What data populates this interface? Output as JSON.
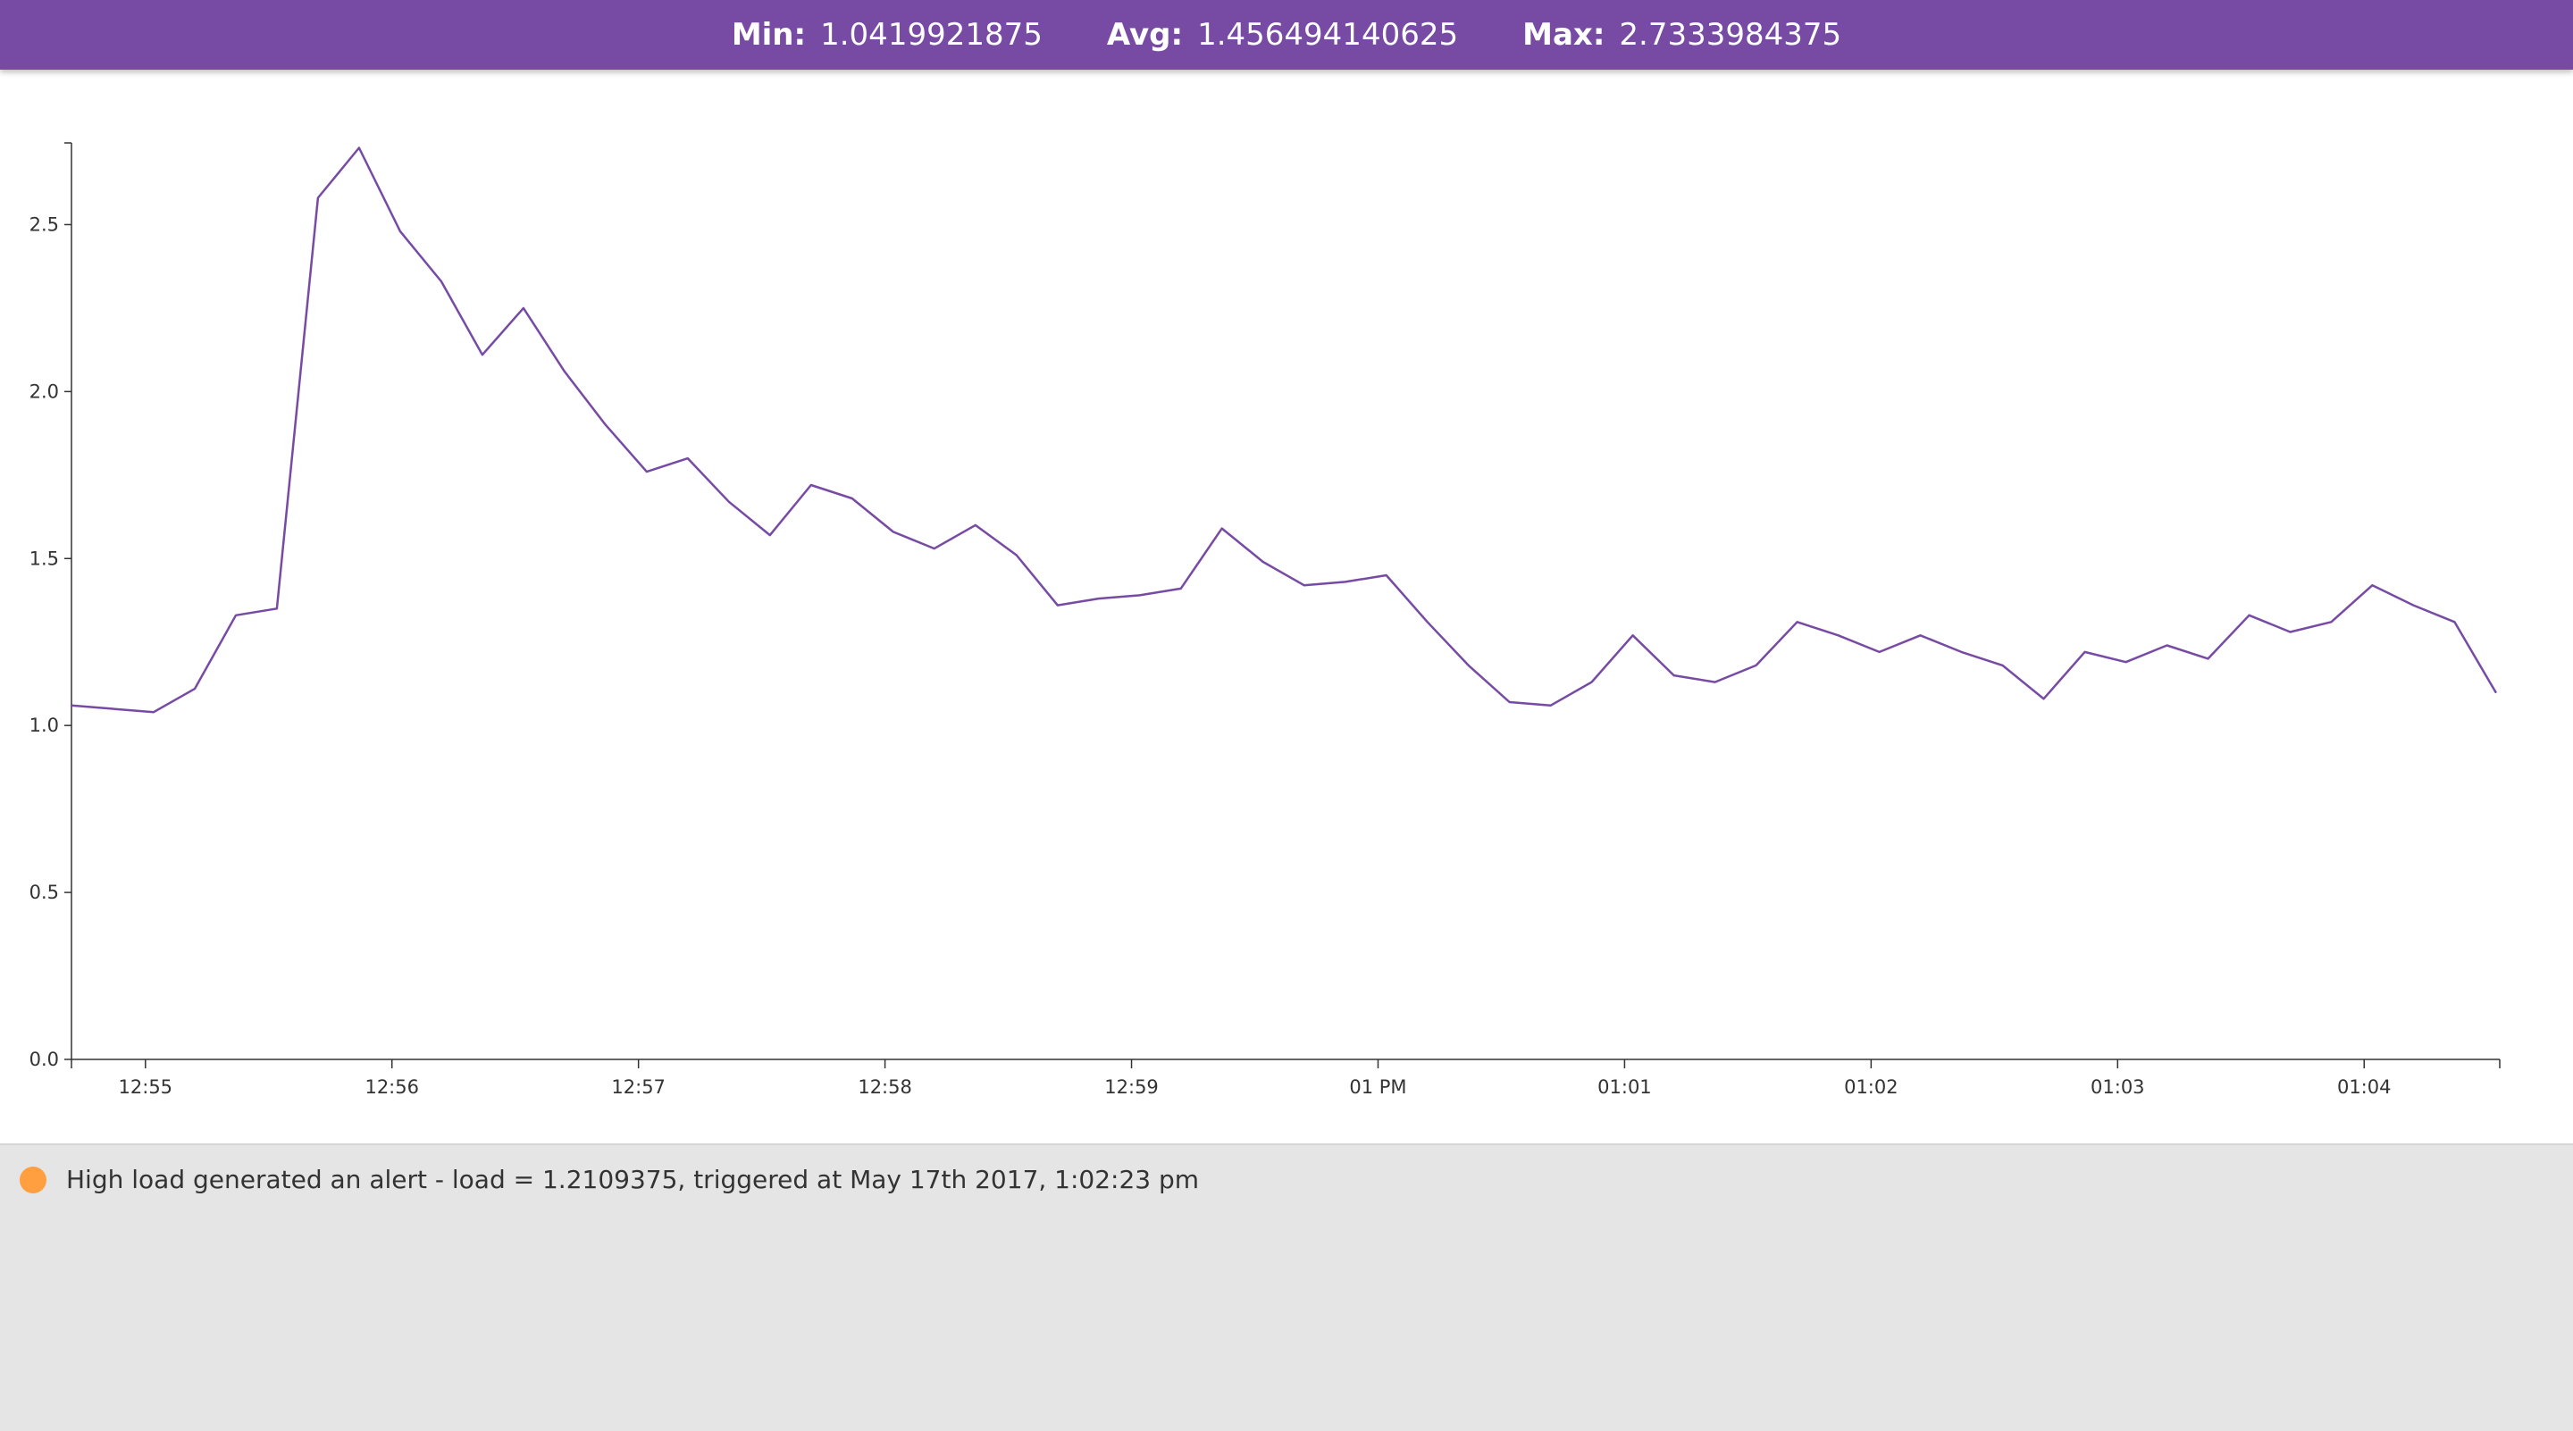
{
  "header": {
    "min_label": "Min:",
    "min_value": "1.0419921875",
    "avg_label": "Avg:",
    "avg_value": "1.456494140625",
    "max_label": "Max:",
    "max_value": "2.7333984375"
  },
  "chart_data": {
    "type": "line",
    "title": "",
    "xlabel": "",
    "ylabel": "",
    "grid": false,
    "ylim": [
      0,
      2.75
    ],
    "yticks": [
      "0.0",
      "0.5",
      "1.0",
      "1.5",
      "2.0",
      "2.5"
    ],
    "xticks": [
      "12:55",
      "12:56",
      "12:57",
      "12:58",
      "12:59",
      "01 PM",
      "01:01",
      "01:02",
      "01:03",
      "01:04"
    ],
    "xlim": [
      "12:54:42",
      "01:04:33"
    ],
    "line_color": "#774aa4",
    "series": [
      {
        "x": [
          "12:54:42",
          "12:55:02",
          "12:55:12",
          "12:55:22",
          "12:55:32",
          "12:55:42",
          "12:55:52",
          "12:56:02",
          "12:56:12",
          "12:56:22",
          "12:56:32",
          "12:56:42",
          "12:56:52",
          "12:57:02",
          "12:57:12",
          "12:57:22",
          "12:57:32",
          "12:57:42",
          "12:57:52",
          "12:58:02",
          "12:58:12",
          "12:58:22",
          "12:58:32",
          "12:58:42",
          "12:58:52",
          "12:59:02",
          "12:59:12",
          "12:59:22",
          "12:59:32",
          "12:59:42",
          "12:59:52",
          "13:00:02",
          "13:00:12",
          "13:00:22",
          "13:00:32",
          "13:00:42",
          "13:00:52",
          "13:01:02",
          "13:01:12",
          "13:01:22",
          "13:01:32",
          "13:01:42",
          "13:01:52",
          "13:02:02",
          "13:02:12",
          "13:02:22",
          "13:02:32",
          "13:02:42",
          "13:02:52",
          "13:03:02",
          "13:03:12",
          "13:03:22",
          "13:03:32",
          "13:03:42",
          "13:03:52",
          "13:04:02",
          "13:04:12",
          "13:04:22",
          "13:04:32"
        ],
        "values": [
          1.06,
          1.04,
          1.11,
          1.33,
          1.35,
          2.58,
          2.73,
          2.48,
          2.33,
          2.11,
          2.25,
          2.06,
          1.9,
          1.76,
          1.8,
          1.67,
          1.57,
          1.72,
          1.68,
          1.58,
          1.53,
          1.6,
          1.51,
          1.36,
          1.38,
          1.39,
          1.41,
          1.59,
          1.49,
          1.42,
          1.43,
          1.45,
          1.31,
          1.18,
          1.07,
          1.06,
          1.13,
          1.27,
          1.15,
          1.13,
          1.18,
          1.31,
          1.27,
          1.22,
          1.27,
          1.22,
          1.18,
          1.08,
          1.22,
          1.19,
          1.24,
          1.2,
          1.33,
          1.28,
          1.31,
          1.42,
          1.36,
          1.31,
          1.1
        ]
      }
    ]
  },
  "alerts": [
    {
      "text": "High load generated an alert - load = 1.2109375, triggered at May 17th 2017, 1:02:23 pm",
      "dot_color": "#ff9f40"
    }
  ]
}
